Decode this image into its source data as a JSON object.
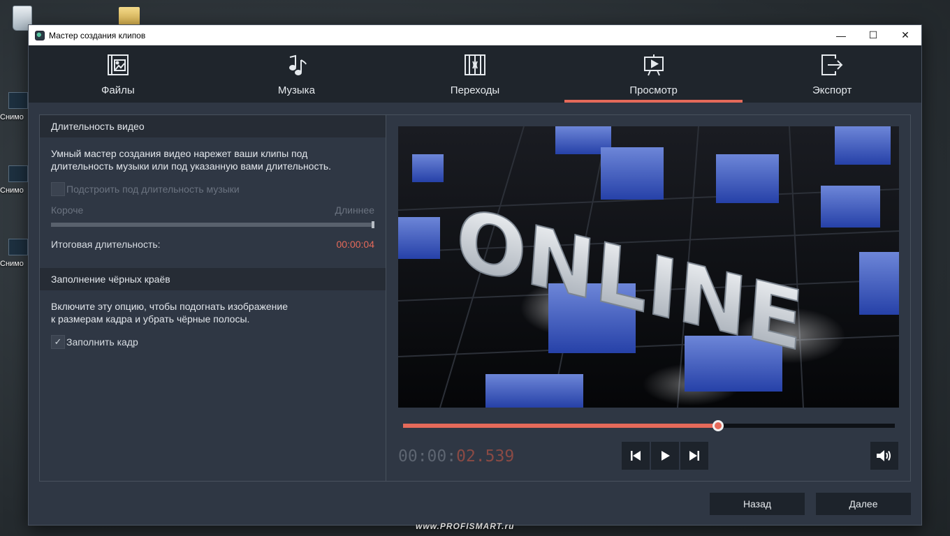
{
  "desktop": {
    "icons": [
      {
        "label": "Снимо"
      },
      {
        "label": "Снимо"
      },
      {
        "label": "Снимо"
      }
    ],
    "watermark": "www.PROFISMART.ru"
  },
  "window": {
    "title": "Мастер создания клипов",
    "controls": {
      "minimize": "—",
      "maximize": "☐",
      "close": "✕"
    }
  },
  "tabs": [
    {
      "label": "Файлы",
      "icon": "files-icon"
    },
    {
      "label": "Музыка",
      "icon": "music-icon"
    },
    {
      "label": "Переходы",
      "icon": "transitions-icon"
    },
    {
      "label": "Просмотр",
      "icon": "preview-icon",
      "active": true
    },
    {
      "label": "Экспорт",
      "icon": "export-icon"
    }
  ],
  "duration_section": {
    "heading": "Длительность видео",
    "description_line1": "Умный мастер создания видео нарежет ваши клипы под",
    "description_line2": "длительность музыки или под указанную вами длительность.",
    "fit_music_label": "Подстроить под длительность музыки",
    "fit_music_checked": false,
    "shorter_label": "Короче",
    "longer_label": "Длиннее",
    "slider_level": 1.0,
    "total_label": "Итоговая длительность:",
    "total_value": "00:00:04"
  },
  "fill_section": {
    "heading": "Заполнение чёрных краёв",
    "description_line1": "Включите эту опцию, чтобы подогнать изображение",
    "description_line2": "к размерам кадра и убрать чёрные полосы.",
    "fill_label": "Заполнить кадр",
    "fill_checked": true
  },
  "player": {
    "preview_text": "ONLINE",
    "progress": 0.64,
    "timecode_dim": "00:00:",
    "timecode_hot": "02.539",
    "prev_icon": "skip-back-icon",
    "play_icon": "play-icon",
    "next_icon": "skip-forward-icon",
    "volume_icon": "volume-icon"
  },
  "footer": {
    "back_label": "Назад",
    "next_label": "Далее"
  },
  "colors": {
    "accent": "#e56a5a",
    "tab_bg": "#1f252c",
    "panel_bg": "#2f3744"
  }
}
